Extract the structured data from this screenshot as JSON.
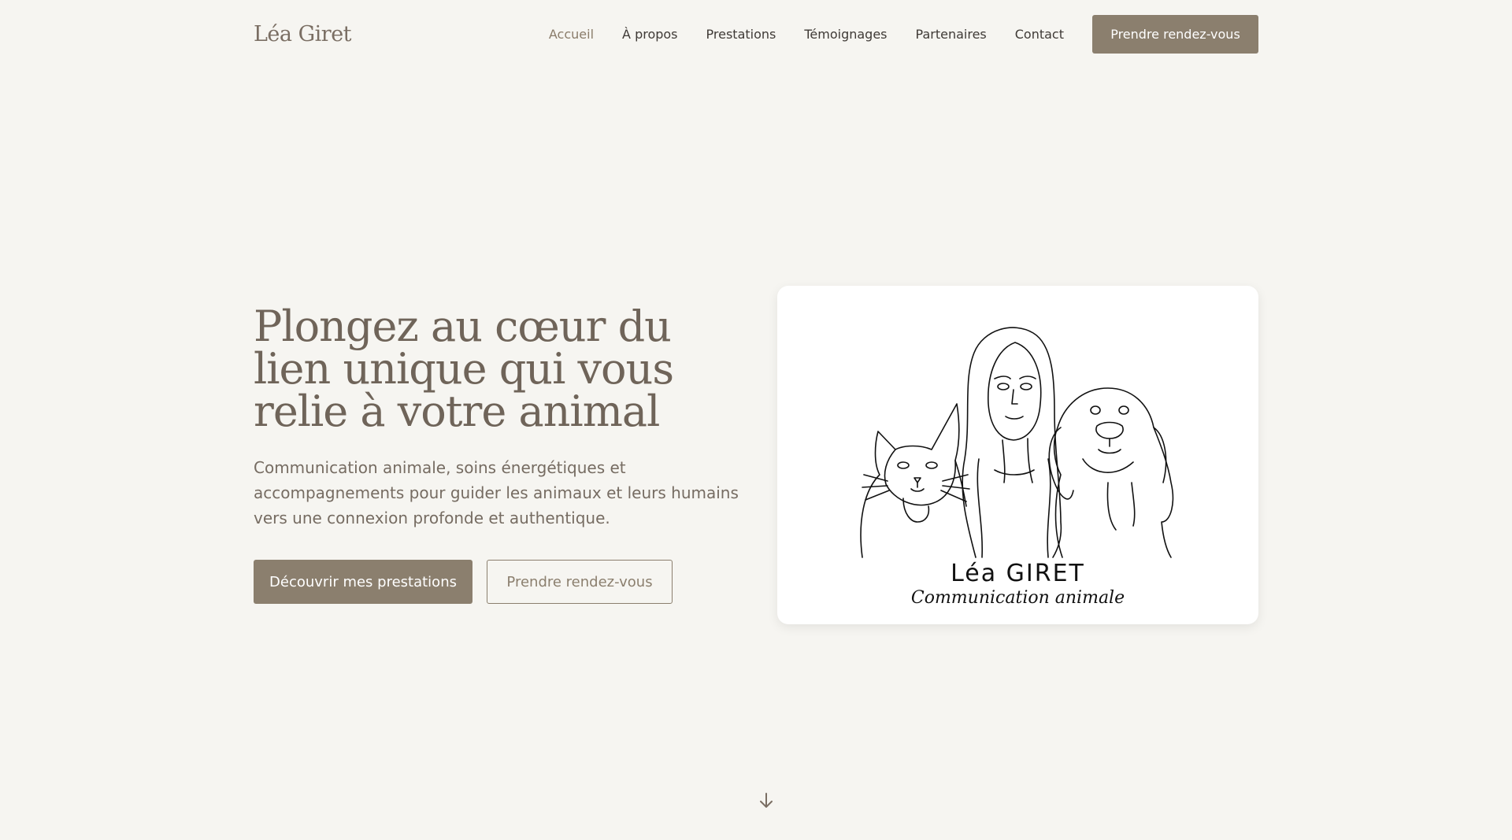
{
  "header": {
    "logo": "Léa Giret",
    "nav": [
      "Accueil",
      "À propos",
      "Prestations",
      "Témoignages",
      "Partenaires",
      "Contact"
    ],
    "cta": "Prendre rendez-vous"
  },
  "hero": {
    "title": "Plongez au cœur du lien unique qui vous relie à votre animal",
    "subtitle": "Communication animale, soins énergétiques et accompagnements pour guider les animaux et leurs humains vers une connexion profonde et authentique.",
    "primary_button": "Découvrir mes prestations",
    "secondary_button": "Prendre rendez-vous"
  },
  "card": {
    "name": "Léa GIRET",
    "tagline": "Communication animale"
  },
  "icons": {
    "scroll": "arrow-down-icon"
  },
  "colors": {
    "background": "#f6f5f1",
    "accent": "#8b7f6e",
    "heading": "#6f6459"
  }
}
